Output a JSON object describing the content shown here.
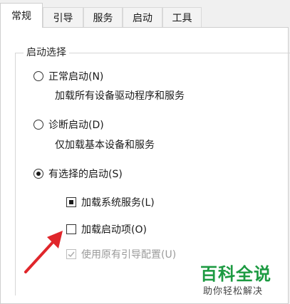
{
  "tabs": [
    {
      "label": "常规"
    },
    {
      "label": "引导"
    },
    {
      "label": "服务"
    },
    {
      "label": "启动"
    },
    {
      "label": "工具"
    }
  ],
  "group": {
    "title": "启动选择",
    "normal": {
      "label": "正常启动(N)",
      "description": "加载所有设备驱动程序和服务"
    },
    "diagnostic": {
      "label": "诊断启动(D)",
      "description": "仅加载基本设备和服务"
    },
    "selective": {
      "label": "有选择的启动(S)"
    },
    "checkboxes": {
      "load_system_services": {
        "label": "加载系统服务(L)",
        "state": "indeterminate"
      },
      "load_startup_items": {
        "label": "加载启动项(O)",
        "state": "unchecked"
      },
      "use_original_boot": {
        "label": "使用原有引导配置(U)",
        "state": "checked-disabled"
      }
    }
  },
  "watermark": {
    "title": "百科全说",
    "subtitle": "助你轻松解决"
  },
  "colors": {
    "arrow": "#e0262b",
    "watermark": "#1c9a41"
  }
}
